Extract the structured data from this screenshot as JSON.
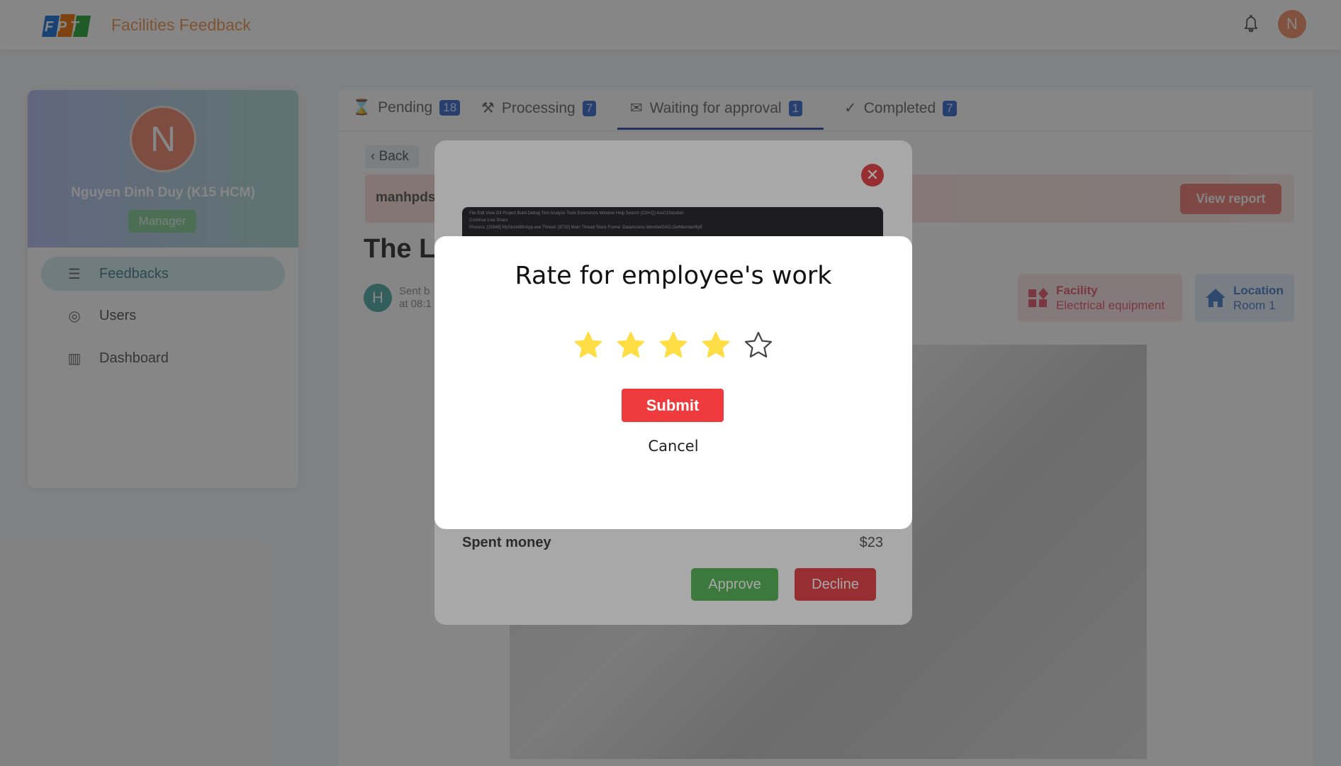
{
  "header": {
    "logo_text": "FPT",
    "app_title": "Facilities Feedback",
    "user_initial": "N"
  },
  "sidebar": {
    "avatar_initial": "N",
    "user_name": "Nguyen Dinh Duy (K15 HCM)",
    "role": "Manager",
    "items": [
      {
        "label": "Feedbacks",
        "icon": "list-icon",
        "active": true
      },
      {
        "label": "Users",
        "icon": "user-circle-icon"
      },
      {
        "label": "Dashboard",
        "icon": "chart-icon"
      }
    ]
  },
  "tabs": [
    {
      "label": "Pending",
      "count": "18",
      "icon": "hourglass-icon"
    },
    {
      "label": "Processing",
      "count": "7",
      "icon": "hammer-icon"
    },
    {
      "label": "Waiting for approval",
      "count": "1",
      "icon": "inbox-icon",
      "active": true
    },
    {
      "label": "Completed",
      "count": "7",
      "icon": "check-icon"
    }
  ],
  "detail": {
    "back_label": "Back",
    "reporter": "manhpds",
    "view_report_label": "View report",
    "title": "The Li",
    "sender_initial": "H",
    "sent_by": "Sent b",
    "sent_at": "at 08:1",
    "facility": {
      "label": "Facility",
      "value": "Electrical equipment"
    },
    "location": {
      "label": "Location",
      "value": "Room 1"
    }
  },
  "report_modal": {
    "screenshot_menu": "File  Edit  View  Git  Project  Build  Debug  Test  Analyze  Tools  Extensions  Window  Help   Search (Ctrl+Q)   Ass01Solution",
    "screenshot_toolbar": "Continue   Live Share",
    "screenshot_process": "Process: [15648] MyStoreWinApp.exe   Thread: [8732] Main Thread   Stack Frame: DataAccess.MemberDAO.GetMemberByE",
    "spent_label": "Spent money",
    "spent_value": "$23",
    "approve_label": "Approve",
    "decline_label": "Decline"
  },
  "rating_modal": {
    "title": "Rate for employee's work",
    "rating": 4,
    "max_rating": 5,
    "submit_label": "Submit",
    "cancel_label": "Cancel",
    "star_color": "#FFDD44"
  }
}
